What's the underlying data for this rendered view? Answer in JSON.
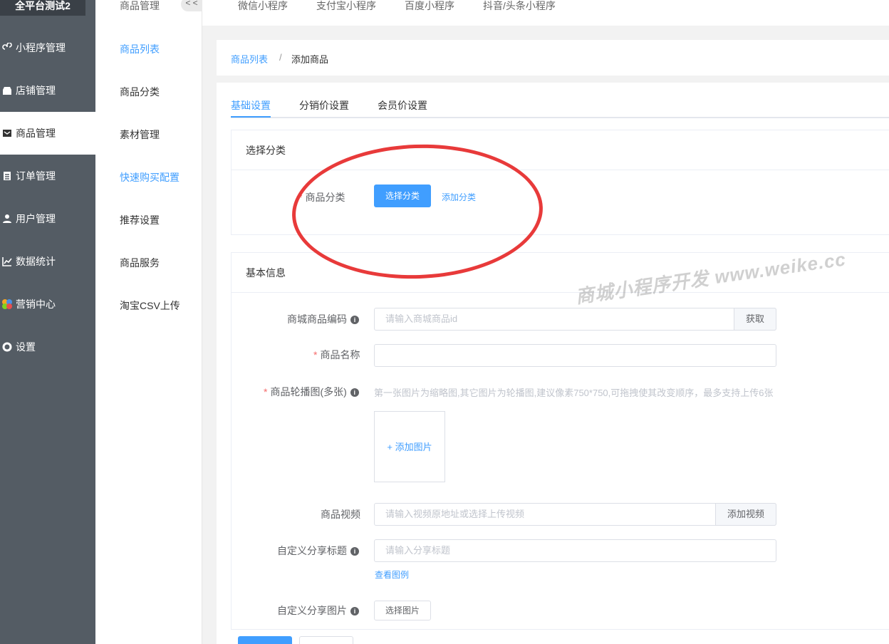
{
  "sidebar": {
    "brand": "全平台测试2",
    "items": [
      {
        "label": "小程序管理",
        "icon": "miniprogram-icon"
      },
      {
        "label": "店铺管理",
        "icon": "store-icon"
      },
      {
        "label": "商品管理",
        "icon": "goods-icon"
      },
      {
        "label": "订单管理",
        "icon": "order-icon"
      },
      {
        "label": "用户管理",
        "icon": "user-icon"
      },
      {
        "label": "数据统计",
        "icon": "chart-icon"
      },
      {
        "label": "营销中心",
        "icon": "marketing-icon"
      },
      {
        "label": "设置",
        "icon": "gear-icon"
      }
    ]
  },
  "submenu": {
    "title": "商品管理",
    "collapse": "< <",
    "items": [
      {
        "label": "商品列表"
      },
      {
        "label": "商品分类"
      },
      {
        "label": "素材管理"
      },
      {
        "label": "快速购买配置"
      },
      {
        "label": "推荐设置"
      },
      {
        "label": "商品服务"
      },
      {
        "label": "淘宝CSV上传"
      }
    ]
  },
  "top_tabs": [
    "微信小程序",
    "支付宝小程序",
    "百度小程序",
    "抖音/头条小程序"
  ],
  "breadcrumb": {
    "link": "商品列表",
    "separator": "/",
    "current": "添加商品"
  },
  "tabs": [
    "基础设置",
    "分销价设置",
    "会员价设置"
  ],
  "category_section": {
    "title": "选择分类",
    "label": "商品分类",
    "required": "*",
    "choose_button": "选择分类",
    "add_link": "添加分类"
  },
  "basic_section": {
    "title": "基本信息",
    "code": {
      "label": "商城商品编码",
      "placeholder": "请输入商城商品id",
      "button": "获取"
    },
    "name": {
      "label": "商品名称",
      "required": "*"
    },
    "carousel": {
      "label": "商品轮播图(多张)",
      "required": "*",
      "hint": "第一张图片为缩略图,其它图片为轮播图,建议像素750*750,可拖拽使其改变顺序，最多支持上传6张",
      "upload": "+ 添加图片"
    },
    "video": {
      "label": "商品视频",
      "placeholder": "请输入视频原地址或选择上传视频",
      "button": "添加视频"
    },
    "share_title": {
      "label": "自定义分享标题",
      "placeholder": "请输入分享标题",
      "example_link": "查看图例"
    },
    "share_image": {
      "label": "自定义分享图片",
      "button": "选择图片"
    }
  },
  "watermark": "商城小程序开发 www.weike.cc",
  "info_glyph": "i"
}
